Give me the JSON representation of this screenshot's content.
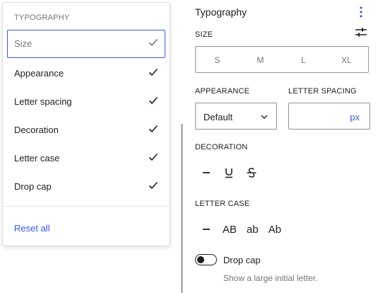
{
  "panel": {
    "title": "Typography",
    "size": {
      "label": "SIZE",
      "options": [
        "S",
        "M",
        "L",
        "XL"
      ]
    },
    "appearance": {
      "label": "APPEARANCE",
      "value": "Default"
    },
    "letter_spacing": {
      "label": "LETTER SPACING",
      "unit": "px"
    },
    "decoration": {
      "label": "DECORATION",
      "options": [
        "none",
        "underline",
        "strikethrough"
      ]
    },
    "letter_case": {
      "label": "LETTER CASE",
      "options": [
        "AB",
        "ab",
        "Ab"
      ]
    },
    "drop_cap": {
      "label": "Drop cap",
      "help": "Show a large initial letter.",
      "enabled": false
    }
  },
  "menu": {
    "heading": "TYPOGRAPHY",
    "items": [
      {
        "label": "Size",
        "checked": true,
        "focused": true
      },
      {
        "label": "Appearance",
        "checked": true
      },
      {
        "label": "Letter spacing",
        "checked": true
      },
      {
        "label": "Decoration",
        "checked": true
      },
      {
        "label": "Letter case",
        "checked": true
      },
      {
        "label": "Drop cap",
        "checked": true
      }
    ],
    "reset": "Reset all"
  },
  "colors": {
    "accent": "#3858e9",
    "text": "#1e1e1e",
    "muted": "#757575",
    "border": "#949494"
  }
}
